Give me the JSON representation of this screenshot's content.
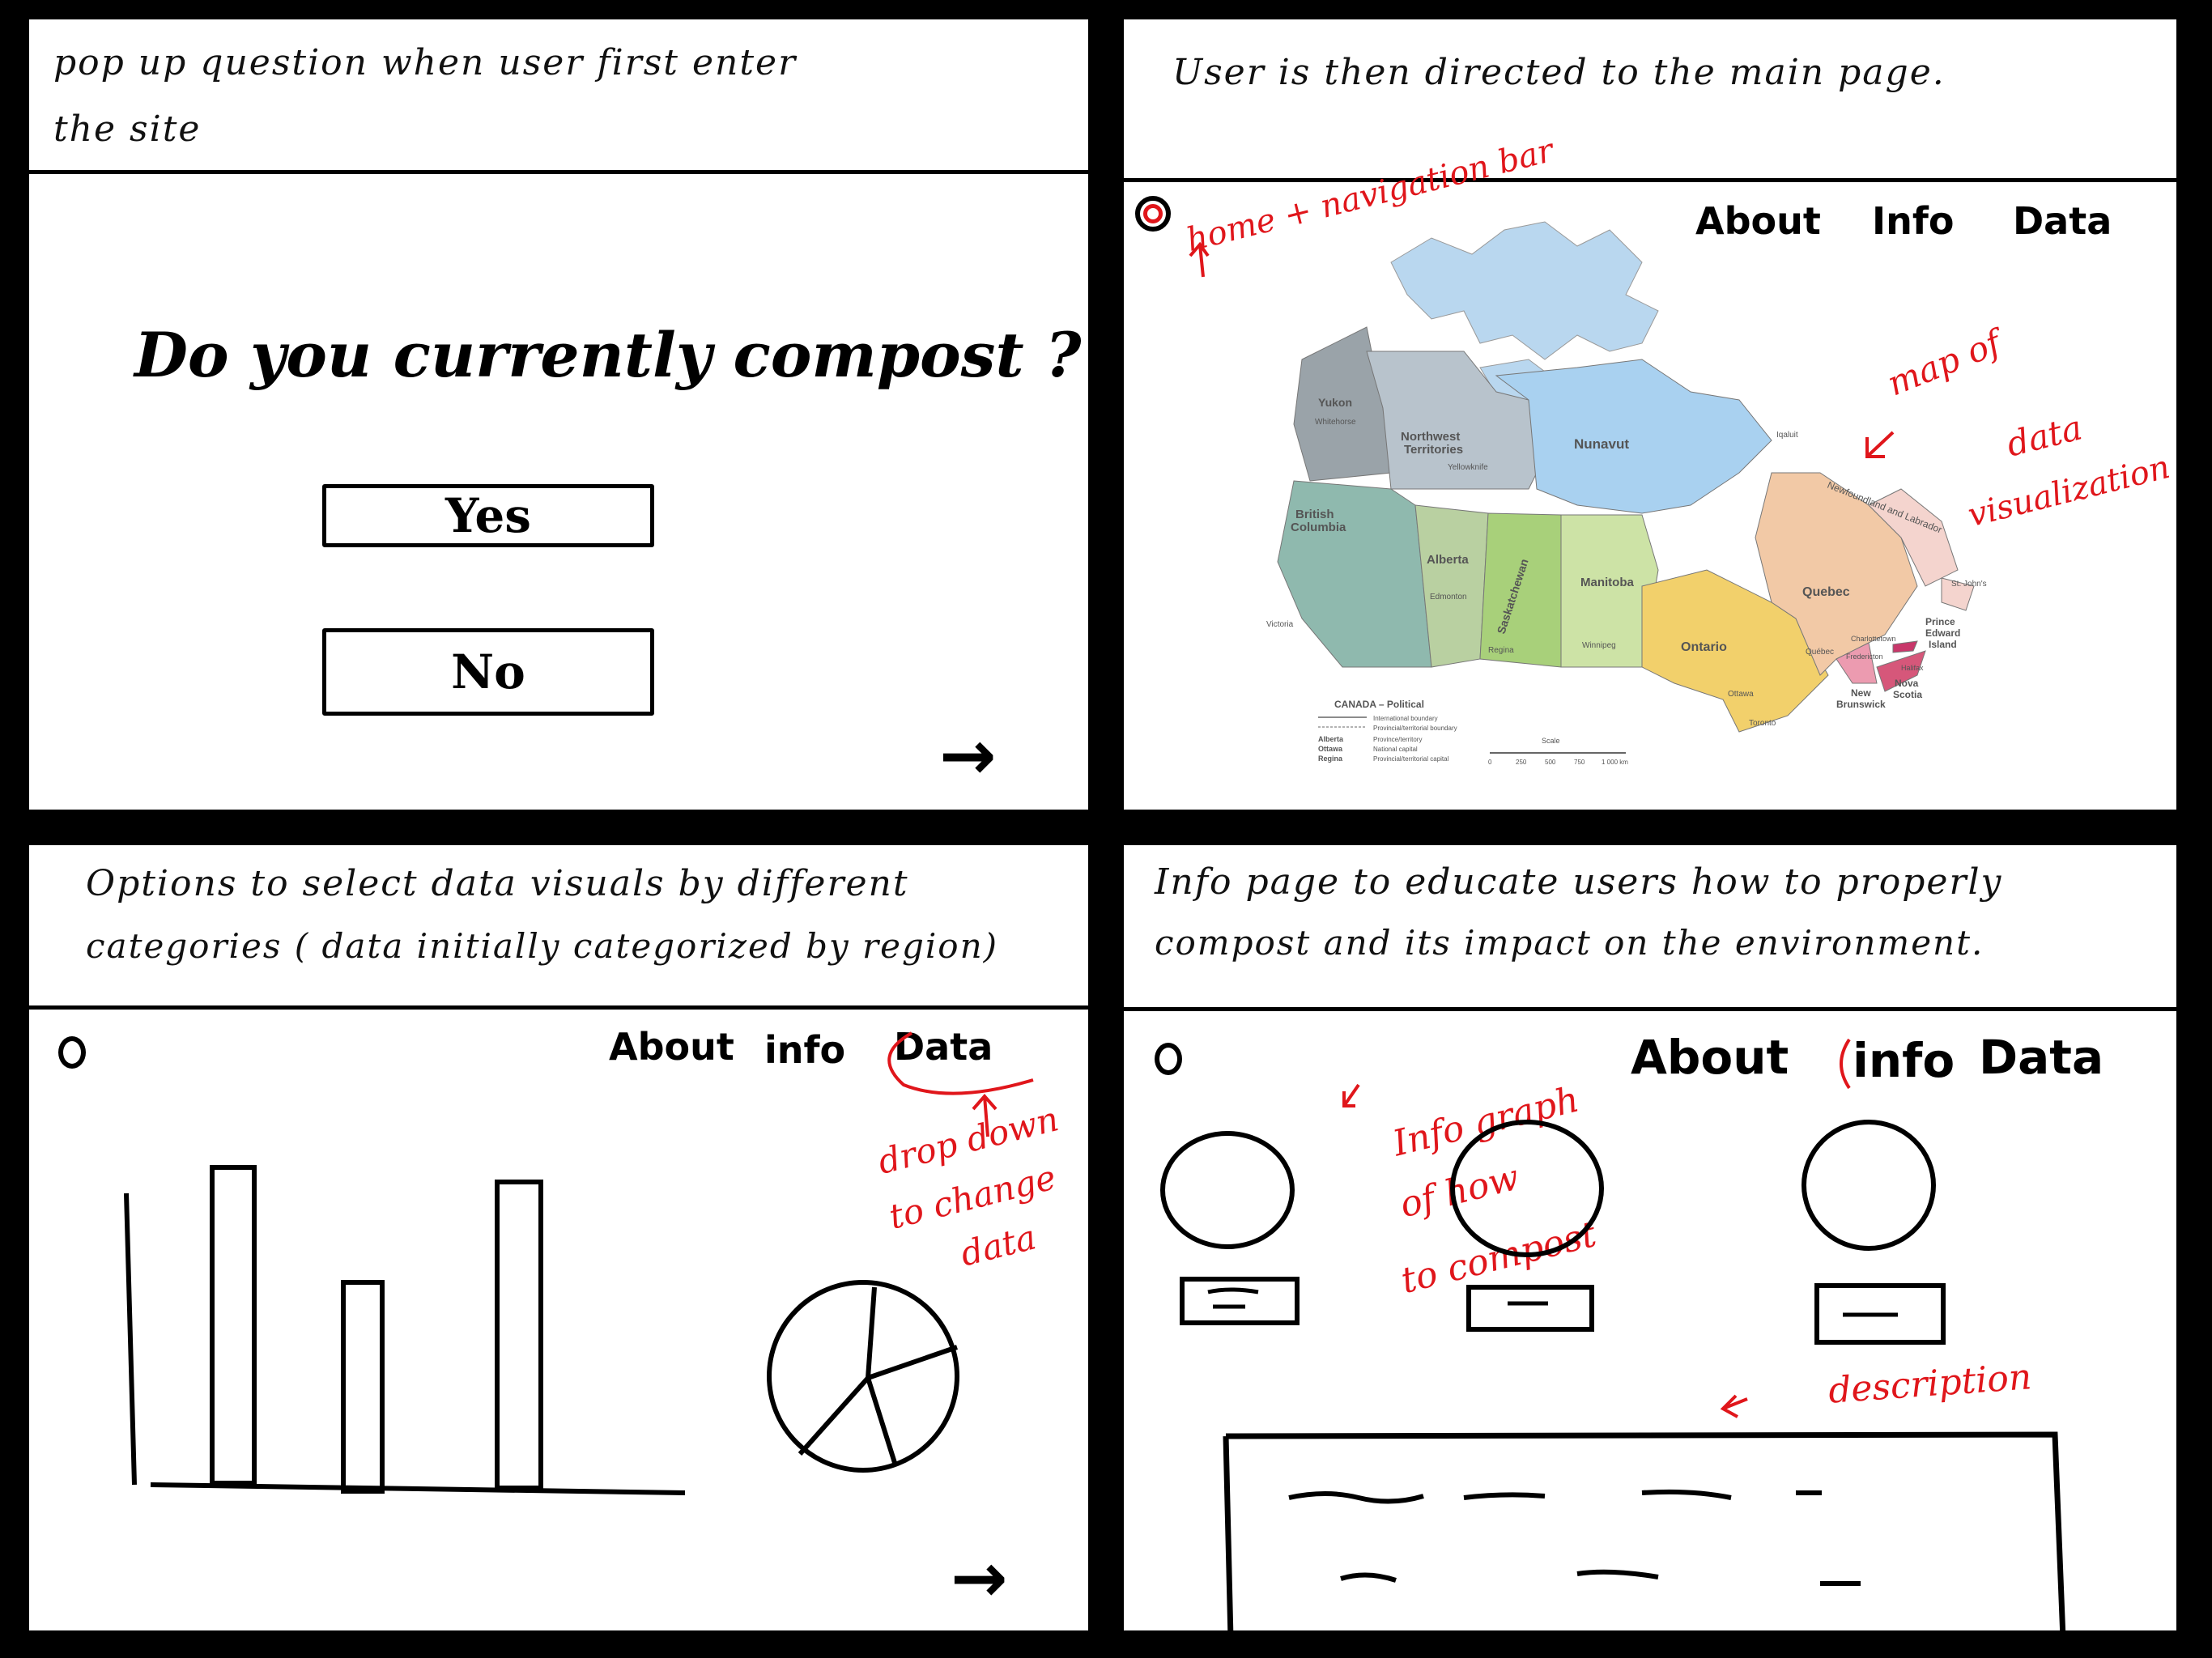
{
  "panel1": {
    "caption_line1": "pop up question when user first enter",
    "caption_line2": "the site",
    "question": "Do you currently compost ?",
    "yes_label": "Yes",
    "no_label": "No",
    "next_arrow": "→"
  },
  "panel2": {
    "caption": "User is then directed to the main page.",
    "nav": {
      "about": "About",
      "info": "Info",
      "data": "Data"
    },
    "annotation_nav": "home + navigation bar",
    "annotation_map_1": "map of",
    "annotation_map_2": "data",
    "annotation_map_3": "visualization",
    "map": {
      "provinces": [
        "Yukon",
        "Northwest Territories",
        "Nunavut",
        "British Columbia",
        "Alberta",
        "Saskatchewan",
        "Manitoba",
        "Ontario",
        "Quebec",
        "Newfoundland and Labrador",
        "New Brunswick",
        "Nova Scotia",
        "Prince Edward Island"
      ],
      "cities": [
        "Whitehorse",
        "Yellowknife",
        "Iqaluit",
        "Victoria",
        "Edmonton",
        "Regina",
        "Winnipeg",
        "Ottawa",
        "Toronto",
        "Québec",
        "Fredericton",
        "Charlottetown",
        "Halifax",
        "St. John's"
      ],
      "legend_title": "CANADA – Political",
      "legend_items": [
        "International boundary",
        "Provincial/territorial boundary",
        "Province/territory",
        "National capital",
        "Provincial/territorial capital"
      ],
      "legend_samples": [
        "Alberta",
        "Ottawa",
        "Regina"
      ],
      "scale_label": "Scale",
      "scale_ticks": [
        "0",
        "250",
        "500",
        "750",
        "1 000 km"
      ]
    }
  },
  "panel3": {
    "caption_line1": "Options to select data visuals by different",
    "caption_line2": "categories ( data initially categorized by region)",
    "nav": {
      "about": "About",
      "info": "info",
      "data": "Data"
    },
    "annotation_1": "drop down",
    "annotation_2": "to change",
    "annotation_3": "data",
    "next_arrow": "→"
  },
  "panel4": {
    "caption_line1": "Info page to educate users how to properly",
    "caption_line2": "compost and its impact on the environment.",
    "nav": {
      "about": "About",
      "info": "info",
      "data": "Data"
    },
    "annotation_info_1": "Info graph",
    "annotation_info_2": "of how",
    "annotation_info_3": "to compost",
    "annotation_desc": "description"
  },
  "colors": {
    "annotation_red": "#e0161b",
    "ink": "#000000"
  }
}
